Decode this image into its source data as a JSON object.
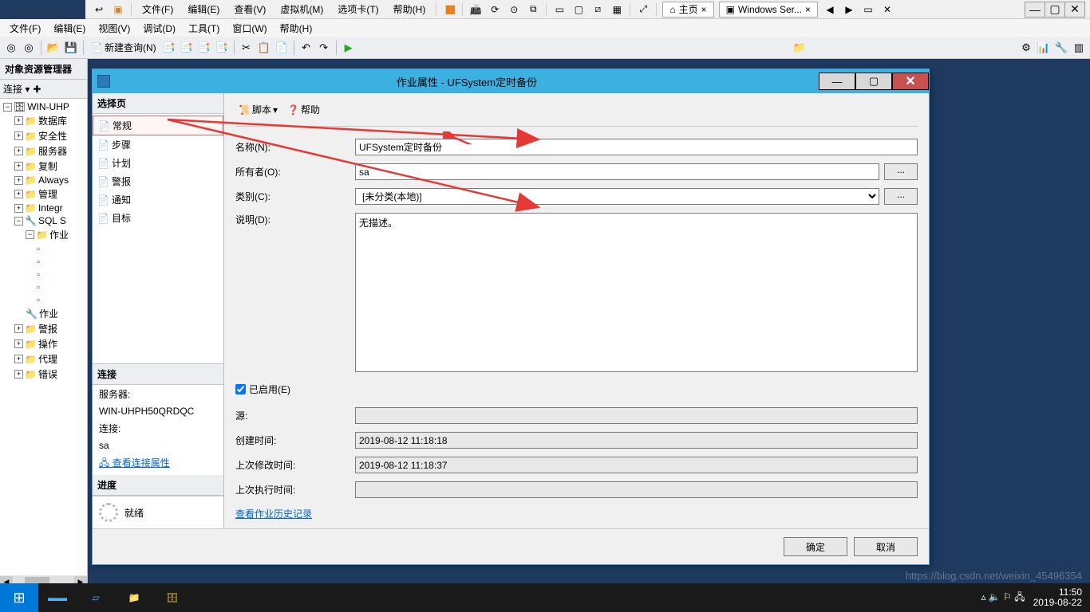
{
  "vmmenu": {
    "file": "文件(F)",
    "edit": "编辑(E)",
    "view": "查看(V)",
    "vm": "虚拟机(M)",
    "tab": "选项卡(T)",
    "help": "帮助(H)",
    "home": "主页",
    "wintab": "Windows Ser..."
  },
  "ssms_menu": {
    "file": "文件(F)",
    "edit": "编辑(E)",
    "view": "视图(V)",
    "debug": "调试(D)",
    "tools": "工具(T)",
    "window": "窗口(W)",
    "help": "帮助(H)"
  },
  "toolbar": {
    "newquery": "新建查询(N)"
  },
  "explorer": {
    "title": "对象资源管理器",
    "connect": "连接",
    "root": "WIN-UHP",
    "nodes": [
      "数据库",
      "安全性",
      "服务器",
      "复制",
      "Always",
      "管理",
      "Integr",
      "SQL S",
      "作业",
      "作业",
      "警报",
      "操作",
      "代理",
      "错误"
    ]
  },
  "dialog": {
    "title": "作业属性 - UFSystem定时备份",
    "select_page": "选择页",
    "pages": [
      "常规",
      "步骤",
      "计划",
      "警报",
      "通知",
      "目标"
    ],
    "connection_hdr": "连接",
    "server_label": "服务器:",
    "server": "WIN-UHPH50QRDQC",
    "conn_label": "连接:",
    "conn_user": "sa",
    "view_conn": "查看连接属性",
    "progress_hdr": "进度",
    "progress": "就绪",
    "script": "脚本",
    "help": "帮助",
    "f_name": "名称(N):",
    "v_name": "UFSystem定时备份",
    "f_owner": "所有者(O):",
    "v_owner": "sa",
    "f_cat": "类别(C):",
    "v_cat": "[未分类(本地)]",
    "f_desc": "说明(D):",
    "v_desc": "无描述。",
    "f_enabled": "已启用(E)",
    "f_source": "源:",
    "v_source": "",
    "f_created": "创建时间:",
    "v_created": "2019-08-12 11:18:18",
    "f_modified": "上次修改时间:",
    "v_modified": "2019-08-12 11:18:37",
    "f_executed": "上次执行时间:",
    "v_executed": "",
    "history_link": "查看作业历史记录",
    "ok": "确定",
    "cancel": "取消"
  },
  "status": {
    "ready": "就绪"
  },
  "tray": {
    "time": "11:50",
    "date": "2019-08-22"
  },
  "watermark": "https://blog.csdn.net/weixin_45496354"
}
